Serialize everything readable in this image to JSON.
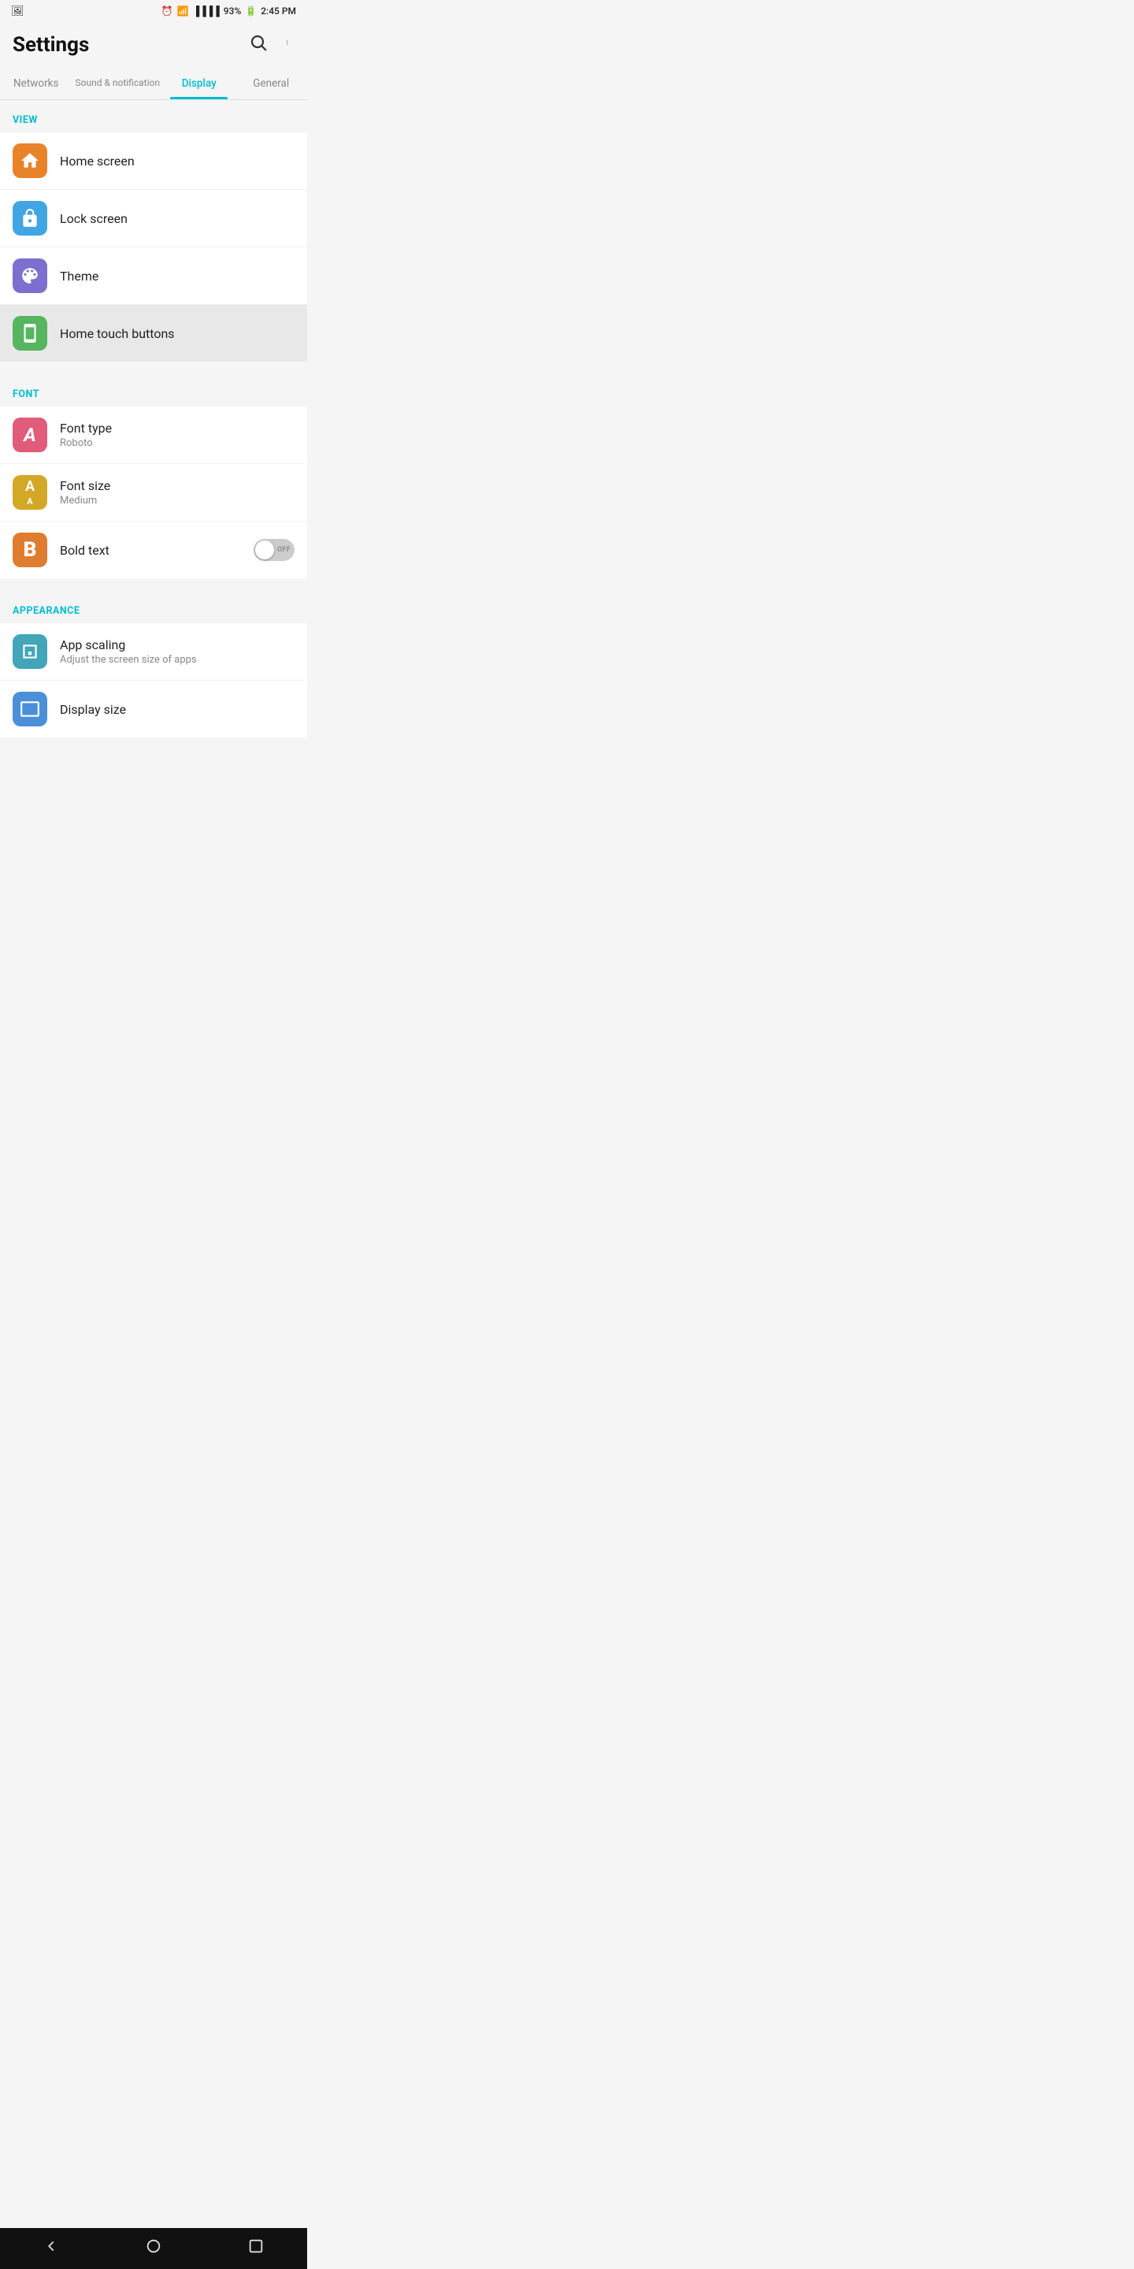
{
  "statusBar": {
    "time": "2:45 PM",
    "battery": "93%",
    "leftIcon": "🖼"
  },
  "header": {
    "title": "Settings",
    "searchLabel": "search",
    "moreLabel": "more options"
  },
  "tabs": [
    {
      "id": "networks",
      "label": "Networks",
      "active": false
    },
    {
      "id": "sound",
      "label": "Sound & notification",
      "active": false
    },
    {
      "id": "display",
      "label": "Display",
      "active": true
    },
    {
      "id": "general",
      "label": "General",
      "active": false
    }
  ],
  "sections": [
    {
      "id": "view",
      "label": "VIEW",
      "items": [
        {
          "id": "home-screen",
          "icon": "home",
          "iconColor": "orange",
          "title": "Home screen",
          "subtitle": null,
          "toggle": null
        },
        {
          "id": "lock-screen",
          "icon": "lock",
          "iconColor": "blue",
          "title": "Lock screen",
          "subtitle": null,
          "toggle": null
        },
        {
          "id": "theme",
          "icon": "theme",
          "iconColor": "purple",
          "title": "Theme",
          "subtitle": null,
          "toggle": null
        },
        {
          "id": "home-touch",
          "icon": "touch",
          "iconColor": "green",
          "title": "Home touch buttons",
          "subtitle": null,
          "toggle": null,
          "highlighted": true
        }
      ]
    },
    {
      "id": "font",
      "label": "FONT",
      "items": [
        {
          "id": "font-type",
          "icon": "font-a",
          "iconColor": "pink",
          "title": "Font type",
          "subtitle": "Roboto",
          "toggle": null
        },
        {
          "id": "font-size",
          "icon": "font-size",
          "iconColor": "yellow",
          "title": "Font size",
          "subtitle": "Medium",
          "toggle": null
        },
        {
          "id": "bold-text",
          "icon": "bold",
          "iconColor": "orange2",
          "title": "Bold text",
          "subtitle": null,
          "toggle": {
            "state": "off"
          }
        }
      ]
    },
    {
      "id": "appearance",
      "label": "APPEARANCE",
      "items": [
        {
          "id": "app-scaling",
          "icon": "scale",
          "iconColor": "teal",
          "title": "App scaling",
          "subtitle": "Adjust the screen size of apps",
          "toggle": null
        },
        {
          "id": "display-size",
          "icon": "display",
          "iconColor": "blue2",
          "title": "Display size",
          "subtitle": null,
          "toggle": null,
          "partial": true
        }
      ]
    }
  ],
  "bottomNav": {
    "backLabel": "back",
    "homeLabel": "home",
    "recentLabel": "recent"
  }
}
